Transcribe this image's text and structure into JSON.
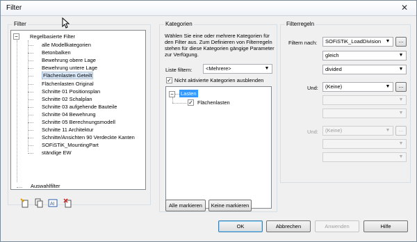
{
  "window": {
    "title": "Filter"
  },
  "filter_panel": {
    "label": "Filter",
    "root_rule_based": "Regelbasierte Filter",
    "items": [
      "alle Modellkategorien",
      "Betonbalken",
      "Bewehrung obere Lage",
      "Bewehrung untere Lage",
      "Flächenlasten Geteilt",
      "Flächenlasten Original",
      "Schnitte 01 Positionsplan",
      "Schnitte 02 Schalplan",
      "Schnitte 03 aufgehende Bauteile",
      "Schnitte 04 Bewehrung",
      "Schnitte 05 Berechnungsmodell",
      "Schnitte 11 Architektur",
      "Schnitte/Ansichten 90 Verdeckte Kanten",
      "SOFiSTiK_MountingPart",
      "ständige EW"
    ],
    "selected_index": 4,
    "root_selection": "Auswahlfilter",
    "toolbar_icons": [
      "new-filter-icon",
      "duplicate-filter-icon",
      "rename-filter-icon",
      "delete-filter-icon"
    ]
  },
  "categories_panel": {
    "label": "Kategorien",
    "description": "Wählen Sie eine oder mehrere Kategorien für den Filter aus. Zum Definieren von Filterregeln stehen für diese Kategorien gängige Parameter zur Verfügung.",
    "list_filter_label": "Liste filtern:",
    "list_filter_value": "<Mehrere>",
    "hide_unchecked_label": "Nicht aktivierte Kategorien ausblenden",
    "hide_unchecked_checked": true,
    "tree_root": "Lasten",
    "tree_child": "Flächenlasten",
    "tree_child_checked": true,
    "check_all_button": "Alle markieren",
    "check_none_button": "Keine markieren"
  },
  "rules_panel": {
    "label": "Filterregeln",
    "filter_by_label": "Filtern nach:",
    "filter_by_value": "SOFiSTiK_LoadDivision",
    "operator_value": "gleich",
    "value_value": "divided",
    "and_label_1": "Und:",
    "and_value_1": "(Keine)",
    "and_label_2": "Und:",
    "and_value_2": "(Keine)",
    "dots": "..."
  },
  "buttons": {
    "ok": "OK",
    "cancel": "Abbrechen",
    "apply": "Anwenden",
    "help": "Hilfe"
  }
}
